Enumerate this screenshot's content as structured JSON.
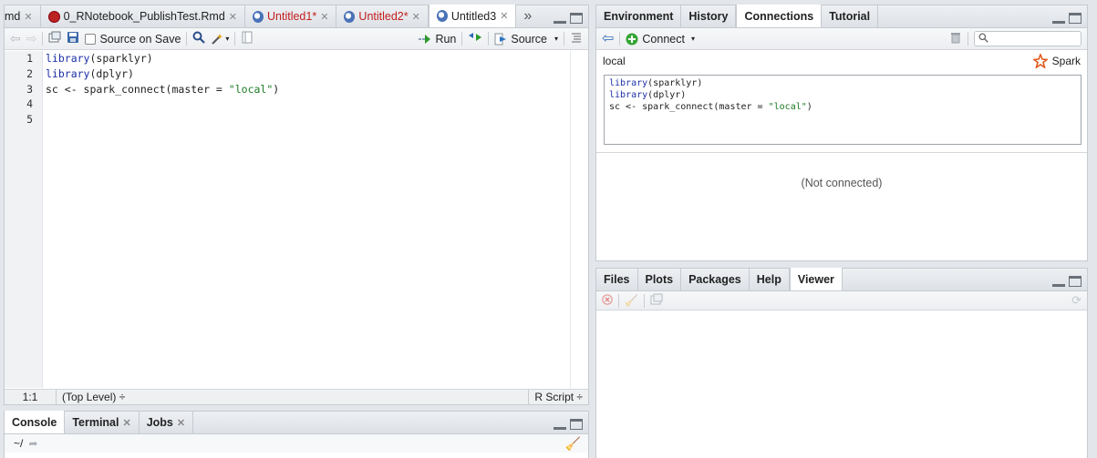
{
  "source_pane": {
    "tabs": [
      {
        "label": "md",
        "icon": "none"
      },
      {
        "label": "0_RNotebook_PublishTest.Rmd",
        "icon": "rmarkdown-icon"
      },
      {
        "label": "Untitled1*",
        "icon": "rscript-icon"
      },
      {
        "label": "Untitled2*",
        "icon": "rscript-icon"
      },
      {
        "label": "Untitled3",
        "icon": "rscript-icon"
      }
    ],
    "overflow_symbol": "»",
    "toolbar": {
      "source_on_save": "Source on Save",
      "run": "Run",
      "source": "Source"
    },
    "line_numbers": [
      "1",
      "2",
      "3",
      "4",
      "5"
    ],
    "code": {
      "line1_fn": "library",
      "line1_arg": "(sparklyr)",
      "line2_fn": "library",
      "line2_arg": "(dplyr)",
      "line3_pre": "sc <- spark_connect(master = ",
      "line3_str": "\"local\"",
      "line3_post": ")"
    },
    "status": {
      "position": "1:1",
      "scope": "(Top Level) ÷",
      "filetype": "R Script ÷"
    }
  },
  "console_pane": {
    "tabs": [
      "Console",
      "Terminal",
      "Jobs"
    ],
    "path": "~/"
  },
  "env_pane": {
    "tabs": [
      "Environment",
      "History",
      "Connections",
      "Tutorial"
    ],
    "active_tab": "Connections",
    "connect_label": "Connect",
    "connection_name": "local",
    "spark_label": "Spark",
    "snippet": {
      "l1_fn": "library",
      "l1_arg": "(sparklyr)",
      "l2_fn": "library",
      "l2_arg": "(dplyr)",
      "l3_pre": "sc <- spark_connect(master = ",
      "l3_str": "\"local\"",
      "l3_post": ")"
    },
    "status_text": "(Not connected)",
    "search_placeholder": ""
  },
  "files_pane": {
    "tabs": [
      "Files",
      "Plots",
      "Packages",
      "Help",
      "Viewer"
    ],
    "active_tab": "Viewer"
  },
  "colors": {
    "keyword": "#1c2fa5",
    "string": "#1b7c23",
    "modified_tab": "#c41e1e",
    "spark_orange": "#e25a1c"
  }
}
